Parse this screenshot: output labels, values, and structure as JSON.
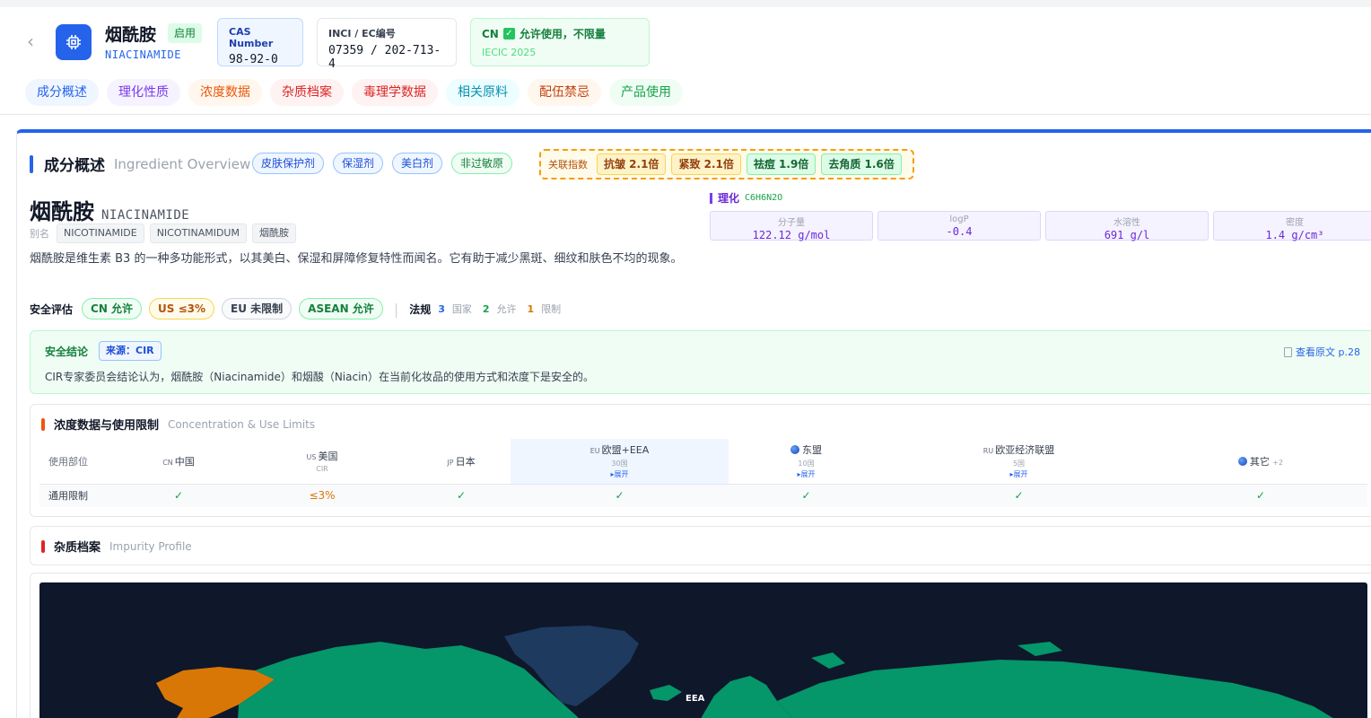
{
  "header": {
    "title_cn": "烟酰胺",
    "status": "启用",
    "title_en": "NIACINAMIDE",
    "cas_label": "CAS Number",
    "cas_value": "98-92-0",
    "inci_label": "INCI / EC编号",
    "inci_value": "07359 / 202-713-4",
    "cn_code": "CN",
    "cn_status": "允许使用，不限量",
    "cn_source": "IECIC 2025"
  },
  "tabs": [
    {
      "label": "成分概述",
      "color": "#2563eb",
      "bg": "#eff6ff"
    },
    {
      "label": "理化性质",
      "color": "#7c3aed",
      "bg": "#f5f3ff"
    },
    {
      "label": "浓度数据",
      "color": "#ea580c",
      "bg": "#fff7ed"
    },
    {
      "label": "杂质档案",
      "color": "#dc2626",
      "bg": "#fef2f2"
    },
    {
      "label": "毒理学数据",
      "color": "#dc2626",
      "bg": "#fef2f2"
    },
    {
      "label": "相关原料",
      "color": "#0891b2",
      "bg": "#ecfeff"
    },
    {
      "label": "配伍禁忌",
      "color": "#c2410c",
      "bg": "#fff7ed"
    },
    {
      "label": "产品使用",
      "color": "#16a34a",
      "bg": "#f0fdf4"
    }
  ],
  "overview": {
    "title": "成分概述",
    "subtitle": "Ingredient Overview",
    "pills": [
      "皮肤保护剂",
      "保湿剂",
      "美白剂"
    ],
    "pill_green": "非过敏原",
    "related_label": "关联指数",
    "related": [
      {
        "label": "抗皱 2.1倍"
      },
      {
        "label": "紧致 2.1倍"
      },
      {
        "label": "祛痘 1.9倍"
      },
      {
        "label": "去角质 1.6倍"
      }
    ],
    "name_cn": "烟酰胺",
    "name_en": "NIACINAMIDE",
    "alias_label": "别名",
    "aliases": [
      "NICOTINAMIDE",
      "NICOTINAMIDUM",
      "烟酰胺"
    ],
    "description": "烟酰胺是维生素 B3 的一种多功能形式，以其美白、保湿和屏障修复特性而闻名。它有助于减少黑斑、细纹和肤色不均的现象。"
  },
  "safety": {
    "label": "安全评估",
    "chips": [
      "CN 允许",
      "US ≤3%",
      "EU 未限制",
      "ASEAN 允许"
    ],
    "regs_label": "法规",
    "countries_num": "3",
    "countries_txt": "国家",
    "allowed_num": "2",
    "allowed_txt": "允许",
    "restricted_num": "1",
    "restricted_txt": "限制"
  },
  "physchem": {
    "title": "理化",
    "formula": "C6H6N2O",
    "items": [
      {
        "k": "分子量",
        "v": "122.12 g/mol"
      },
      {
        "k": "logP",
        "v": "-0.4"
      },
      {
        "k": "水溶性",
        "v": "691 g/l"
      },
      {
        "k": "密度",
        "v": "1.4 g/cm³"
      }
    ]
  },
  "conclusion": {
    "title": "安全结论",
    "source": "来源：CIR",
    "text": "CIR专家委员会结论认为，烟酰胺（Niacinamide）和烟酸（Niacin）在当前化妆品的使用方式和浓度下是安全的。",
    "link": "查看原文 p.28"
  },
  "concentration": {
    "title": "浓度数据与使用限制",
    "subtitle": "Concentration & Use Limits",
    "col_first": "使用部位",
    "columns": [
      {
        "cc": "CN",
        "name": "中国"
      },
      {
        "cc": "US",
        "name": "美国",
        "sub": "CIR"
      },
      {
        "cc": "JP",
        "name": "日本"
      },
      {
        "cc": "EU",
        "name": "欧盟+EEA",
        "sub": "30国",
        "exp": "▸展开"
      },
      {
        "name": "东盟",
        "sub": "10国",
        "exp": "▸展开"
      },
      {
        "cc": "RU",
        "name": "欧亚经济联盟",
        "sub": "5国",
        "exp": "▸展开"
      },
      {
        "name": "其它",
        "more": "+2"
      }
    ],
    "row_label": "通用限制",
    "row_values": [
      "✓",
      "≤3%",
      "✓",
      "✓",
      "✓",
      "✓",
      "✓"
    ]
  },
  "impurity": {
    "title": "杂质档案",
    "subtitle": "Impurity Profile"
  },
  "map": {
    "labels": [
      "EEA"
    ]
  }
}
